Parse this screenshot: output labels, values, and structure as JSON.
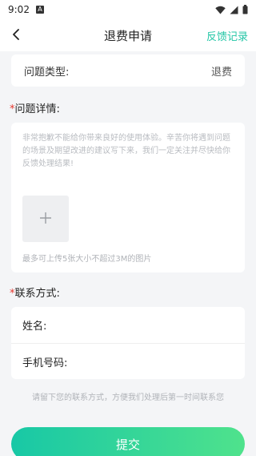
{
  "status_bar": {
    "time": "9:02",
    "notification_icon": "A",
    "icons": [
      "wifi-icon",
      "signal-icon",
      "battery-icon"
    ]
  },
  "nav": {
    "title": "退费申请",
    "right_link": "反馈记录",
    "back_icon": "chevron-left-icon"
  },
  "problem_type": {
    "label": "问题类型:",
    "value": "退费"
  },
  "detail": {
    "required_mark": "*",
    "title": "问题详情:",
    "placeholder": "非常抱歉不能给你带来良好的使用体验。辛苦你将遇到问题 的场景及期望改进的建议写下来，我们一定关注并尽快给你 反馈处理结果!",
    "upload_icon": "plus-icon",
    "upload_hint": "最多可上传5张大小不超过3M的图片"
  },
  "contact": {
    "required_mark": "*",
    "title": "联系方式:",
    "name_label": "姓名:",
    "name_value": "",
    "phone_label": "手机号码:",
    "phone_value": "",
    "hint": "请留下您的联系方式，方便我们处理后第一时间联系您"
  },
  "submit": {
    "label": "提交"
  },
  "colors": {
    "accent": "#23c6a6",
    "required": "#e5362d",
    "button_gradient_start": "#18c8a6",
    "button_gradient_end": "#4fe28c"
  }
}
